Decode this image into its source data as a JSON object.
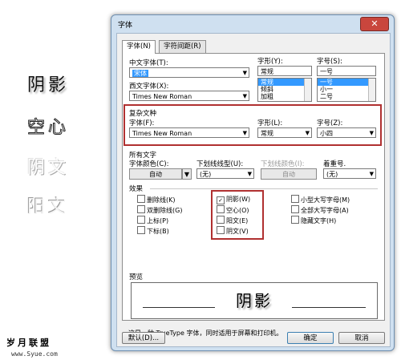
{
  "showcase": [
    "阴影",
    "空心",
    "阴文",
    "阳文"
  ],
  "brand": {
    "name": "岁月联盟",
    "url": "www.Syue.com"
  },
  "dialog": {
    "title": "字体",
    "tabs": [
      "字体(N)",
      "字符间距(R)"
    ],
    "chinese_font": {
      "label": "中文字体(T):",
      "value": "宋体"
    },
    "western_font": {
      "label": "西文字体(X):",
      "value": "Times New Roman"
    },
    "style": {
      "label": "字形(Y):",
      "value": "常规",
      "options": [
        "常规",
        "倾斜",
        "加粗"
      ],
      "selected": "常规"
    },
    "size": {
      "label": "字号(S):",
      "value": "一号",
      "options": [
        "一号",
        "小一",
        "二号"
      ],
      "selected": "一号"
    },
    "complex": {
      "title": "复杂文种",
      "font_label": "字体(F):",
      "font_value": "Times New Roman",
      "style_label": "字形(L):",
      "style_value": "常规",
      "size_label": "字号(Z):",
      "size_value": "小四"
    },
    "all_text": {
      "title": "所有文字",
      "color_label": "字体颜色(C):",
      "color_value": "自动",
      "underline_label": "下划线线型(U):",
      "underline_value": "(无)",
      "underline_color_label": "下划线颜色(I):",
      "underline_color_value": "自动",
      "emphasis_label": "着重号.",
      "emphasis_value": "(无)"
    },
    "effects": {
      "title": "效果",
      "col1": [
        "删除线(K)",
        "双删除线(G)",
        "上标(P)",
        "下标(B)"
      ],
      "col2": [
        "阴影(W)",
        "空心(O)",
        "阳文(E)",
        "阴文(V)"
      ],
      "col3": [
        "小型大写字母(M)",
        "全部大写字母(A)",
        "隐藏文字(H)"
      ],
      "checked": "阴影(W)"
    },
    "preview": {
      "title": "预览",
      "text": "阴影"
    },
    "info": "这是一种 TrueType 字体，同时适用于屏幕和打印机。",
    "buttons": {
      "default": "默认(D)...",
      "ok": "确定",
      "cancel": "取消"
    }
  }
}
